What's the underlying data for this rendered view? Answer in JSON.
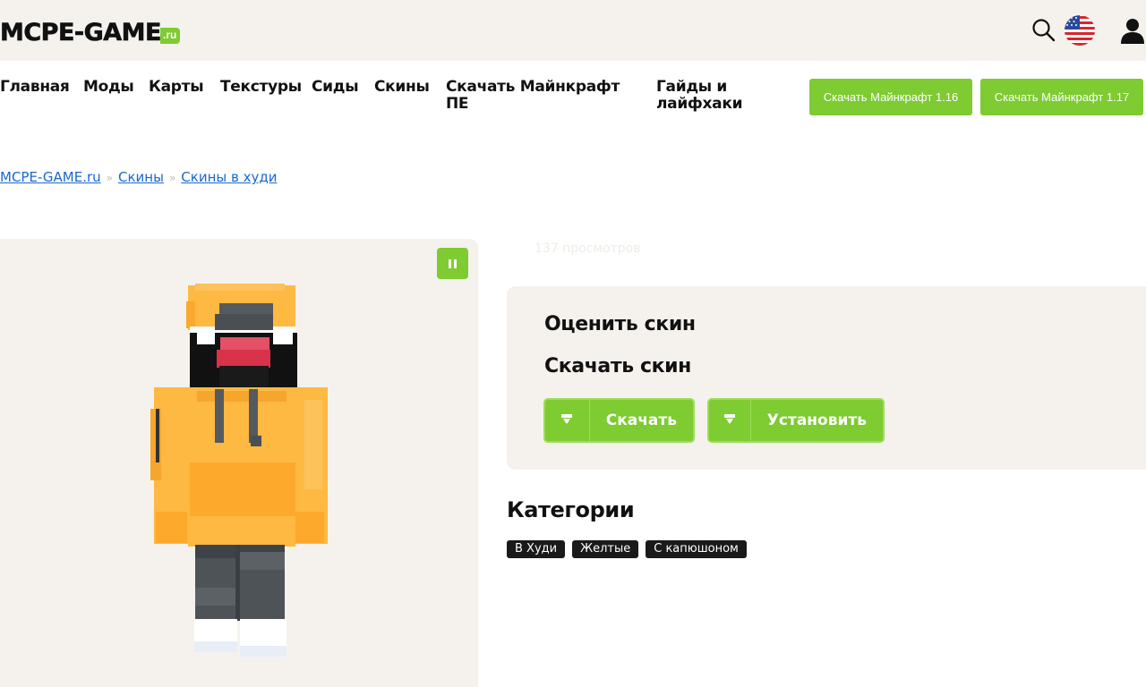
{
  "header": {
    "logo_main": "MCPE-GAME",
    "logo_suffix": ".ru",
    "accent_color": "#7ecb32",
    "icons": [
      "search-icon",
      "us-flag-icon",
      "user-icon"
    ]
  },
  "nav": {
    "items": [
      {
        "label": "Главная"
      },
      {
        "label": "Моды"
      },
      {
        "label": "Карты"
      },
      {
        "label": "Текстуры"
      },
      {
        "label": "Сиды"
      },
      {
        "label": "Скины"
      },
      {
        "label": "Скачать Майнкрафт ПЕ"
      },
      {
        "label": "Гайды и лайфхаки"
      }
    ],
    "buttons": [
      {
        "label": "Скачать Майнкрафт 1.16"
      },
      {
        "label": "Скачать Майнкрафт 1.17"
      }
    ]
  },
  "breadcrumb": {
    "items": [
      "MCPE-GAME.ru",
      "Скины",
      "Скины в худи"
    ],
    "separator": "»"
  },
  "preview": {
    "pause_icon": "pause-icon"
  },
  "views_text": "137 просмотров",
  "actions": {
    "rate_title": "Оценить скин",
    "download_title": "Скачать скин",
    "download_label": "Скачать",
    "install_label": "Установить"
  },
  "categories": {
    "title": "Категории",
    "tags": [
      "В Худи",
      "Желтые",
      "С капюшоном"
    ]
  }
}
